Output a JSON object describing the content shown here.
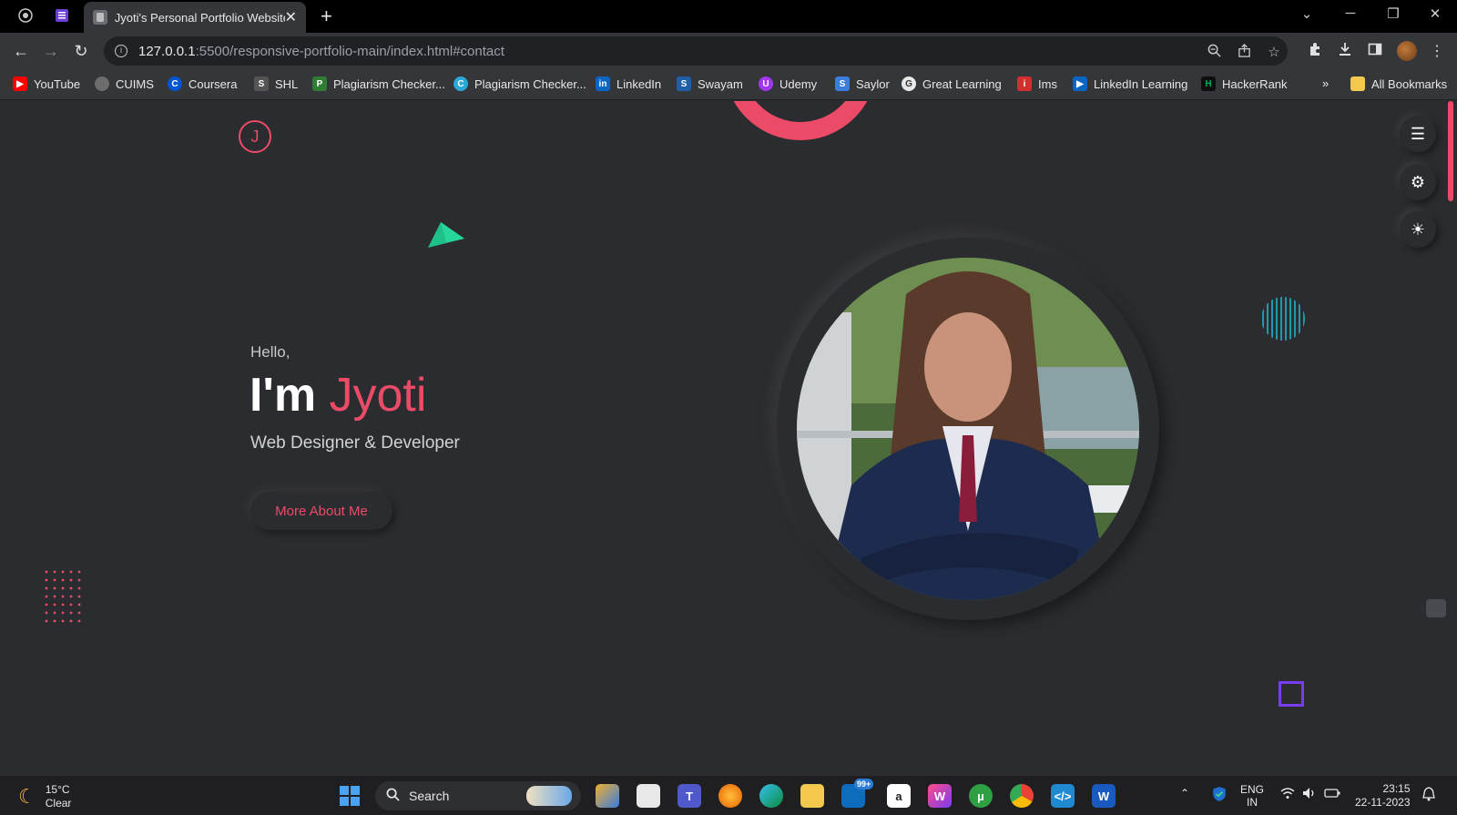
{
  "browser": {
    "tab_title": "Jyoti's Personal Portfolio Website",
    "url_host": "127.0.0.1",
    "url_path": ":5500/responsive-portfolio-main/index.html#contact",
    "bookmarks": [
      {
        "label": "YouTube",
        "icon": "youtube-icon",
        "color": "#ff0000"
      },
      {
        "label": "CUIMS",
        "icon": "globe-icon",
        "color": "#6d6d6d"
      },
      {
        "label": "Coursera",
        "icon": "coursera-icon",
        "color": "#0056d2"
      },
      {
        "label": "SHL",
        "icon": "shl-icon",
        "color": "#555555"
      },
      {
        "label": "Plagiarism Checker...",
        "icon": "plagiarism-icon",
        "color": "#2e7d32"
      },
      {
        "label": "Plagiarism Checker...",
        "icon": "plagiarism-icon",
        "color": "#29a8d8"
      },
      {
        "label": "LinkedIn",
        "icon": "linkedin-icon",
        "color": "#0a66c2"
      },
      {
        "label": "Swayam",
        "icon": "swayam-icon",
        "color": "#1e5fa8"
      },
      {
        "label": "Udemy",
        "icon": "udemy-icon",
        "color": "#a435f0"
      },
      {
        "label": "Saylor",
        "icon": "saylor-icon",
        "color": "#3b7ddd"
      },
      {
        "label": "Great Learning",
        "icon": "great-learning-icon",
        "color": "#e8e8e8"
      },
      {
        "label": "Ims",
        "icon": "ims-icon",
        "color": "#d32f2f"
      },
      {
        "label": "LinkedIn Learning",
        "icon": "linkedin-learning-icon",
        "color": "#0a66c2"
      },
      {
        "label": "HackerRank",
        "icon": "hackerrank-icon",
        "color": "#00b25b"
      }
    ],
    "overflow_label": "»",
    "all_bookmarks_label": "All Bookmarks"
  },
  "page": {
    "logo_letter": "J",
    "hello": "Hello,",
    "headline_prefix": "I'm ",
    "headline_name": "Jyoti",
    "role": "Web Designer & Developer",
    "cta_label": "More About Me",
    "accent_color": "#ec4b68"
  },
  "taskbar": {
    "temperature": "15°C",
    "condition": "Clear",
    "search_label": "Search",
    "mail_badge": "99+",
    "language": "ENG",
    "region": "IN",
    "time": "23:15",
    "date": "22-11-2023"
  }
}
